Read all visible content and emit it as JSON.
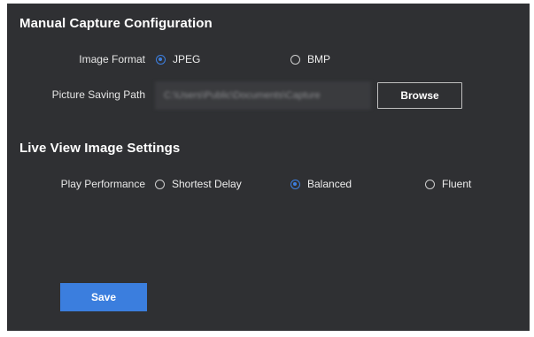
{
  "manual_capture": {
    "title": "Manual Capture Configuration",
    "image_format_label": "Image Format",
    "image_format_options": [
      "JPEG",
      "BMP"
    ],
    "image_format_selected": "JPEG",
    "saving_path_label": "Picture Saving Path",
    "saving_path_value": "C:\\Users\\Public\\Documents\\Capture",
    "browse_label": "Browse"
  },
  "live_view": {
    "title": "Live View Image Settings",
    "play_performance_label": "Play Performance",
    "play_performance_options": [
      "Shortest Delay",
      "Balanced",
      "Fluent"
    ],
    "play_performance_selected": "Balanced"
  },
  "actions": {
    "save_label": "Save"
  },
  "colors": {
    "panel_background": "#2f3033",
    "accent": "#3b7ede"
  }
}
